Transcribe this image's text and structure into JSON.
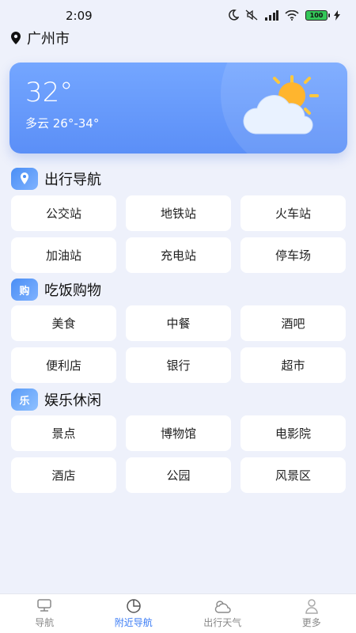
{
  "status_bar": {
    "time": "2:09",
    "battery": "100"
  },
  "location": {
    "city": "广州市"
  },
  "weather": {
    "temperature": "32°",
    "description": "多云 26°-34°"
  },
  "sections": [
    {
      "title": "出行导航",
      "icon": "map-icon",
      "items": [
        "公交站",
        "地铁站",
        "火车站",
        "加油站",
        "充电站",
        "停车场"
      ]
    },
    {
      "title": "吃饭购物",
      "icon": "shopping-icon",
      "icon_text": "购",
      "items": [
        "美食",
        "中餐",
        "酒吧",
        "便利店",
        "银行",
        "超市"
      ]
    },
    {
      "title": "娱乐休闲",
      "icon": "leisure-icon",
      "icon_text": "乐",
      "items": [
        "景点",
        "博物馆",
        "电影院",
        "酒店",
        "公园",
        "风景区"
      ]
    }
  ],
  "bottom_nav": [
    {
      "label": "导航",
      "icon": "compass-icon",
      "active": false
    },
    {
      "label": "附近导航",
      "icon": "pie-icon",
      "active": true
    },
    {
      "label": "出行天气",
      "icon": "weather-icon",
      "active": false
    },
    {
      "label": "更多",
      "icon": "user-icon",
      "active": false
    }
  ],
  "colors": {
    "accent": "#3b7cf5",
    "card": "#5b8ff7",
    "background": "#eef1fb"
  }
}
